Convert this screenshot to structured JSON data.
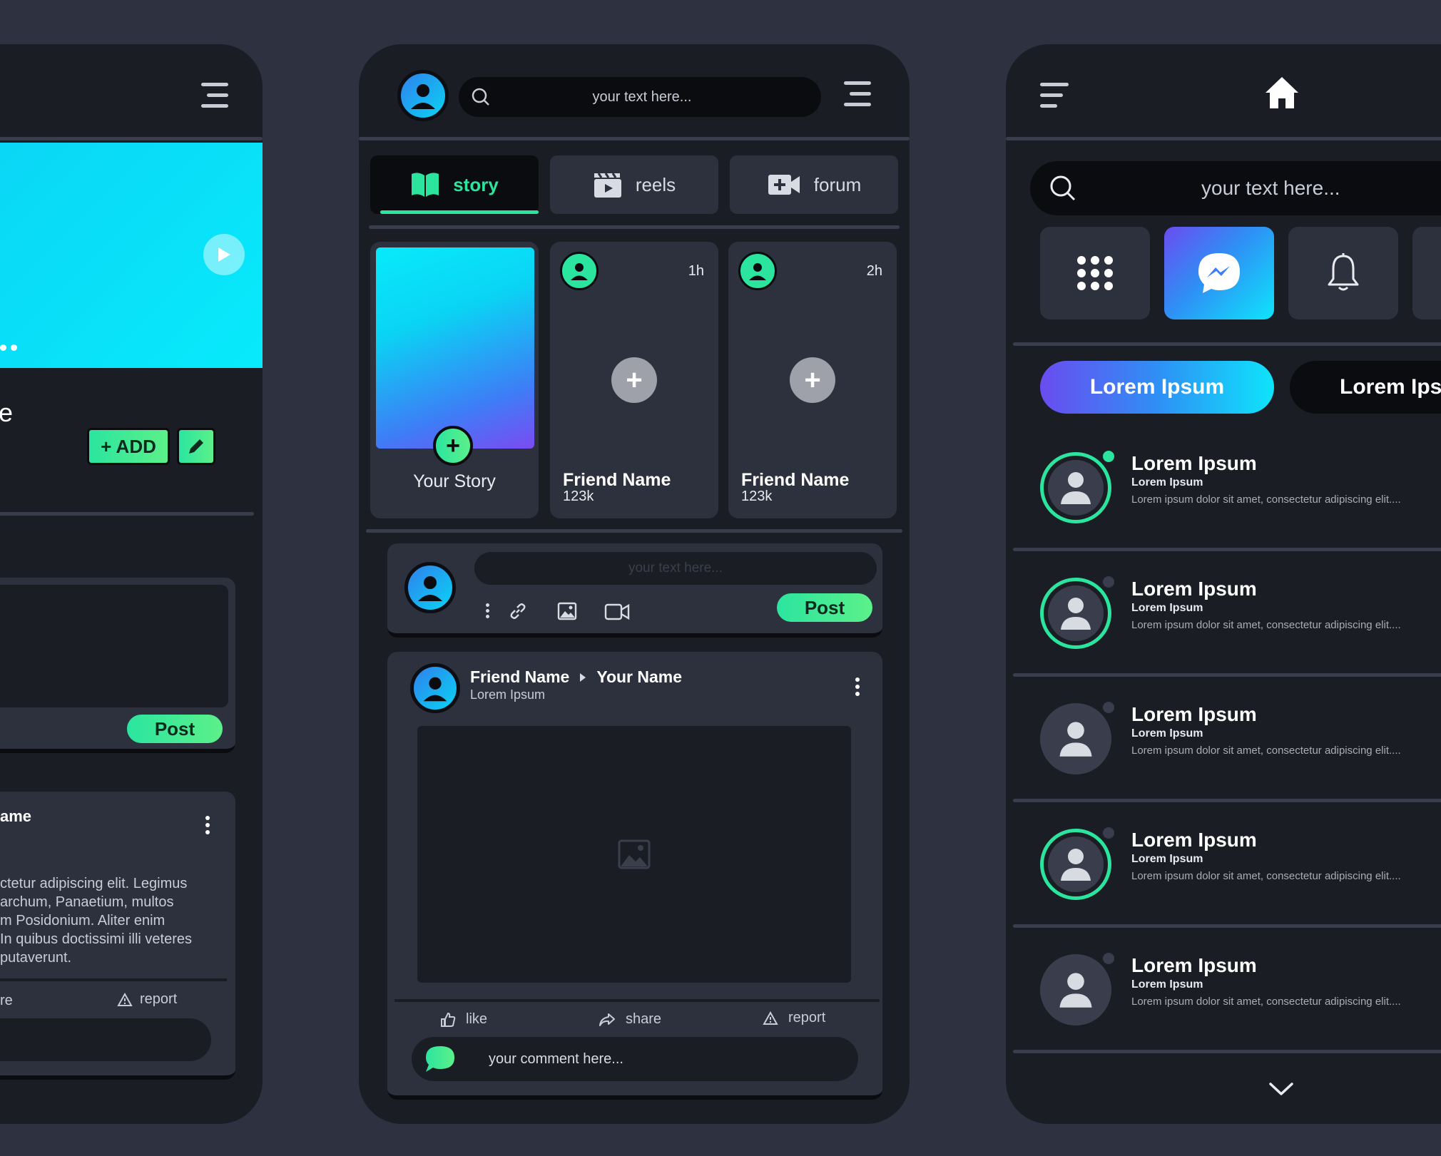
{
  "colors": {
    "background": "#2e3240",
    "panel": "#1b1d25",
    "card": "#2d313d",
    "accent_green": "#2be59f",
    "accent_cyan": "#0ad4f4",
    "accent_purple": "#6a4cf0"
  },
  "left_screen": {
    "title_fragment": "e",
    "add_button": "+ ADD",
    "edit_icon": "pencil-icon",
    "post_button": "Post",
    "post_author_fragment": "ame",
    "post_text": [
      "ctetur adipiscing elit. Legimus",
      "archum, Panaetium, multos",
      "m Posidonium. Aliter enim",
      "In quibus doctissimi illi veteres",
      "putaverunt."
    ],
    "action_share_fragment": "re",
    "action_report": "report"
  },
  "center_screen": {
    "search_placeholder": "your text here...",
    "tabs": [
      {
        "label": "story",
        "icon": "book-icon",
        "active": true
      },
      {
        "label": "reels",
        "icon": "clapper-icon",
        "active": false
      },
      {
        "label": "forum",
        "icon": "video-camera-icon",
        "active": false
      }
    ],
    "stories": [
      {
        "label": "Your Story"
      },
      {
        "name": "Friend Name",
        "count": "123k",
        "time": "1h"
      },
      {
        "name": "Friend Name",
        "count": "123k",
        "time": "2h"
      }
    ],
    "composer": {
      "placeholder": "your text here...",
      "post_button": "Post"
    },
    "feed_post": {
      "author": "Friend Name",
      "target": "Your Name",
      "subtitle": "Lorem Ipsum",
      "actions": {
        "like": "like",
        "share": "share",
        "report": "report"
      },
      "comment_placeholder": "your comment here..."
    }
  },
  "right_screen": {
    "search_placeholder": "your text here...",
    "icon_buttons": [
      "grid-icon",
      "messenger-icon",
      "bell-icon"
    ],
    "pills": [
      "Lorem Ipsum",
      "Lorem Ips"
    ],
    "chats": [
      {
        "title": "Lorem Ipsum",
        "subtitle": "Lorem Ipsum",
        "message": "Lorem ipsum dolor sit amet, consectetur adipiscing elit....",
        "ring": true,
        "online": true
      },
      {
        "title": "Lorem Ipsum",
        "subtitle": "Lorem Ipsum",
        "message": "Lorem ipsum dolor sit amet, consectetur adipiscing elit....",
        "ring": true,
        "online": false
      },
      {
        "title": "Lorem Ipsum",
        "subtitle": "Lorem Ipsum",
        "message": "Lorem ipsum dolor sit amet, consectetur adipiscing elit....",
        "ring": false,
        "online": false
      },
      {
        "title": "Lorem Ipsum",
        "subtitle": "Lorem Ipsum",
        "message": "Lorem ipsum dolor sit amet, consectetur adipiscing elit....",
        "ring": true,
        "online": false
      },
      {
        "title": "Lorem Ipsum",
        "subtitle": "Lorem Ipsum",
        "message": "Lorem ipsum dolor sit amet, consectetur adipiscing elit....",
        "ring": false,
        "online": false
      }
    ]
  }
}
